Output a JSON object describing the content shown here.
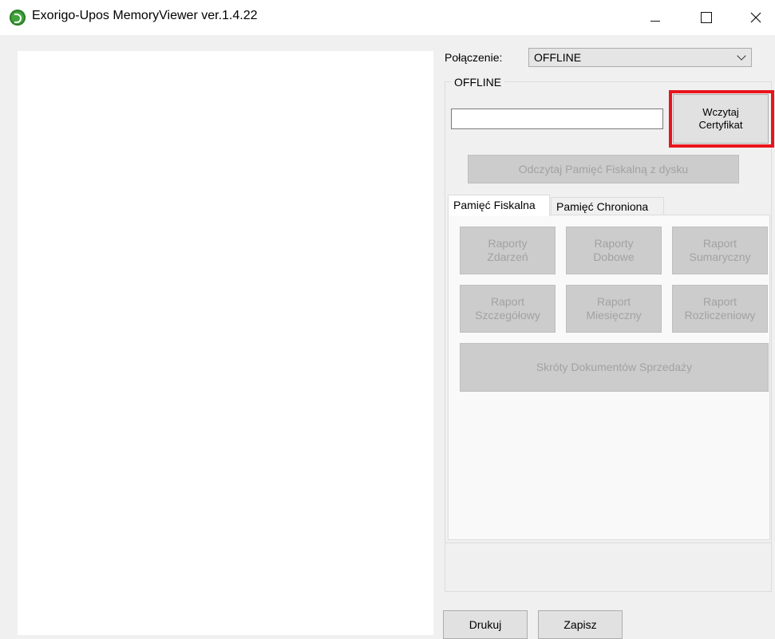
{
  "window": {
    "title": "Exorigo-Upos MemoryViewer ver.1.4.22",
    "controls": {
      "minimize": "minimize-icon",
      "maximize": "maximize-icon",
      "close": "close-icon"
    }
  },
  "connection": {
    "label": "Połączenie:",
    "selected": "OFFLINE"
  },
  "group": {
    "title": "OFFLINE",
    "load_cert_line1": "Wczytaj",
    "load_cert_line2": "Certyfikat",
    "read_disk": "Odczytaj Pamięć Fiskalną z dysku"
  },
  "tabs": [
    {
      "label": "Pamięć Fiskalna",
      "active": true
    },
    {
      "label": "Pamięć Chroniona",
      "active": false
    }
  ],
  "reports": [
    {
      "line1": "Raporty",
      "line2": "Zdarzeń"
    },
    {
      "line1": "Raporty",
      "line2": "Dobowe"
    },
    {
      "line1": "Raport",
      "line2": "Sumaryczny"
    },
    {
      "line1": "Raport",
      "line2": "Szczegółowy"
    },
    {
      "line1": "Raport",
      "line2": "Miesięczny"
    },
    {
      "line1": "Raport",
      "line2": "Rozliczeniowy"
    }
  ],
  "skroty": "Skróty Dokumentów Sprzedaży",
  "bottom": {
    "print": "Drukuj",
    "save": "Zapisz"
  },
  "colors": {
    "highlight": "#e8141c",
    "disabled_text": "#a2a2a2",
    "disabled_bg": "#cccccc",
    "app_icon": "#3fa33a"
  }
}
